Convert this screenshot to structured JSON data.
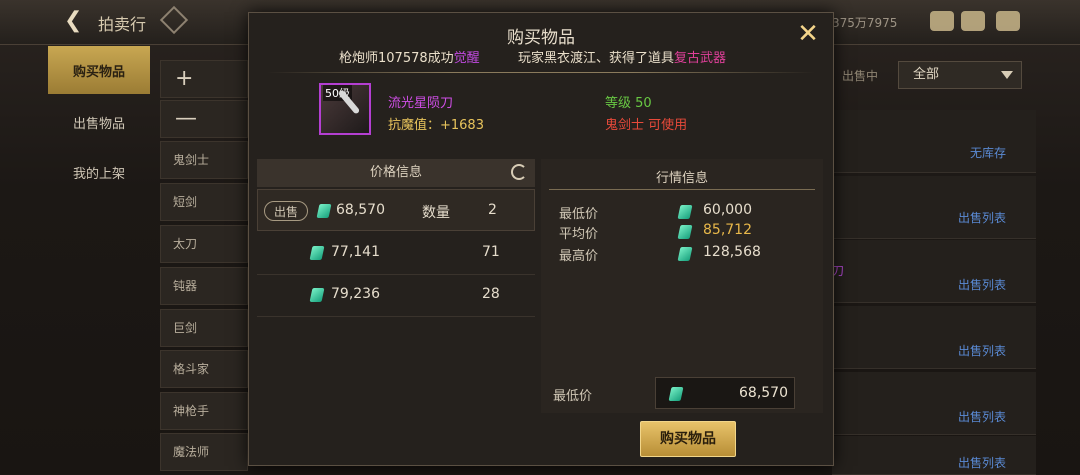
{
  "topbar": {
    "title": "拍卖行",
    "currency": "375万7975"
  },
  "left_tabs": [
    {
      "label": "购买物品",
      "active": true
    },
    {
      "label": "出售物品",
      "active": false
    },
    {
      "label": "我的上架",
      "active": false
    }
  ],
  "categories": [
    {
      "label": "+"
    },
    {
      "label": "—"
    },
    {
      "label": "鬼剑士"
    },
    {
      "label": "短剑"
    },
    {
      "label": "太刀"
    },
    {
      "label": "钝器"
    },
    {
      "label": "巨剑"
    },
    {
      "label": "格斗家"
    },
    {
      "label": "神枪手"
    },
    {
      "label": "魔法师"
    }
  ],
  "right_panel": {
    "status_label": "出售中",
    "filter_value": "全部",
    "rows": [
      {
        "link": "无库存"
      },
      {
        "link": "出售列表"
      },
      {
        "link": "出售列表",
        "purple": "刀"
      },
      {
        "link": "出售列表"
      },
      {
        "link": "出售列表"
      },
      {
        "link": "出售列表"
      }
    ]
  },
  "modal": {
    "title": "购买物品",
    "ticker": {
      "part1": "枪炮师107578成功",
      "part1_hl": "觉醒",
      "part2": "玩家黑衣渡江、获得了道具",
      "part2_hl": "复古武器"
    },
    "item": {
      "level_badge": "50级",
      "name": "流光星陨刀",
      "stat": "抗魔值：+1683",
      "level_label": "等级 50",
      "class_label": "鬼剑士 可使用"
    },
    "price_info": {
      "title": "价格信息",
      "sell_badge": "出售",
      "qty_label": "数量",
      "rows": [
        {
          "price": "68,570",
          "qty": "2"
        },
        {
          "price": "77,141",
          "qty": "71"
        },
        {
          "price": "79,236",
          "qty": "28"
        }
      ]
    },
    "market_info": {
      "title": "行情信息",
      "rows": [
        {
          "label": "最低价",
          "value": "60,000"
        },
        {
          "label": "平均价",
          "value": "85,712"
        },
        {
          "label": "最高价",
          "value": "128,568"
        }
      ]
    },
    "min_price": {
      "label": "最低价",
      "value": "68,570"
    },
    "buy_button": "购买物品",
    "colors": {
      "accent_gold": "#e8b84a",
      "item_purple": "#cf4ee6",
      "level_green": "#68c843",
      "class_red": "#e84a3a"
    }
  }
}
